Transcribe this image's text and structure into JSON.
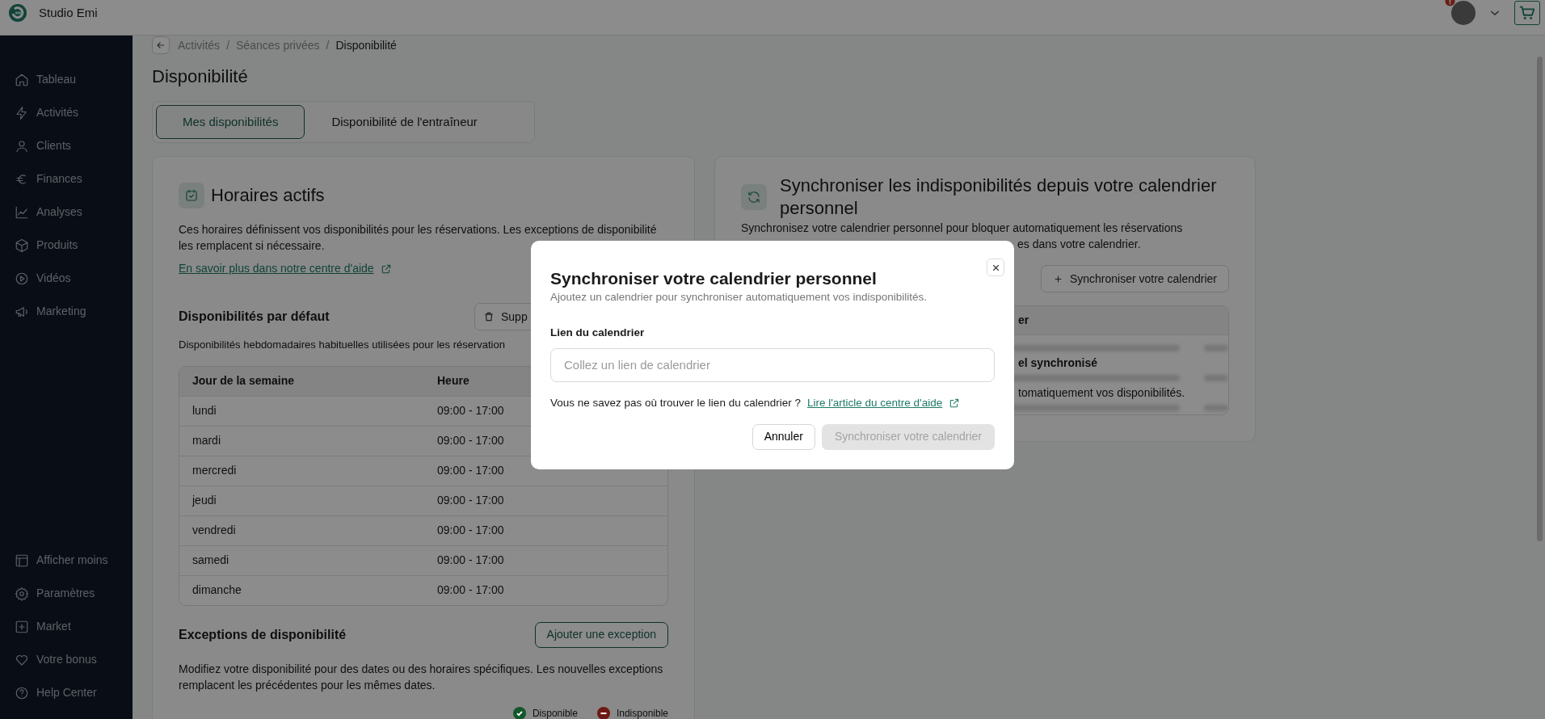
{
  "header": {
    "brand": "Studio Emi"
  },
  "sidebar": {
    "items": [
      {
        "label": "Tableau"
      },
      {
        "label": "Activités"
      },
      {
        "label": "Clients"
      },
      {
        "label": "Finances"
      },
      {
        "label": "Analyses"
      },
      {
        "label": "Produits"
      },
      {
        "label": "Vidéos"
      },
      {
        "label": "Marketing"
      }
    ],
    "bottom_items": [
      {
        "label": "Afficher moins"
      },
      {
        "label": "Paramètres"
      },
      {
        "label": "Market"
      },
      {
        "label": "Votre bonus"
      },
      {
        "label": "Help Center"
      }
    ]
  },
  "breadcrumb": {
    "items": [
      "Activités",
      "Séances privées",
      "Disponibilité"
    ],
    "separators": [
      "/",
      "/"
    ]
  },
  "page_title": "Disponibilité",
  "tabs": [
    {
      "label": "Mes disponibilités",
      "selected": true
    },
    {
      "label": "Disponibilité de l'entraîneur",
      "selected": false
    }
  ],
  "schedule_card": {
    "title": "Horaires actifs",
    "description": "Ces horaires définissent vos disponibilités pour les réservations. Les exceptions de disponibilité les remplacent si nécessaire.",
    "help_link": "En savoir plus dans notre centre d'aide",
    "default_section": {
      "title": "Disponibilités par défaut",
      "delete_button": "Supp",
      "description": "Disponibilités hebdomadaires habituelles utilisées pour les réservation",
      "table": {
        "columns": [
          "Jour de la semaine",
          "Heure"
        ],
        "rows": [
          [
            "lundi",
            "09:00 - 17:00"
          ],
          [
            "mardi",
            "09:00 - 17:00"
          ],
          [
            "mercredi",
            "09:00 - 17:00"
          ],
          [
            "jeudi",
            "09:00 - 17:00"
          ],
          [
            "vendredi",
            "09:00 - 17:00"
          ],
          [
            "samedi",
            "09:00 - 17:00"
          ],
          [
            "dimanche",
            "09:00 - 17:00"
          ]
        ]
      }
    },
    "exceptions_section": {
      "title": "Exceptions de disponibilité",
      "add_button": "Ajouter une exception",
      "description": "Modifiez votre disponibilité pour des dates ou des horaires spécifiques. Les nouvelles exceptions remplacent les précédentes pour les mêmes dates.",
      "legend": [
        {
          "kind": "check",
          "label": "Disponible",
          "color": "#13582a"
        },
        {
          "kind": "minus",
          "label": "Indisponible",
          "color": "#6e1a14"
        }
      ]
    }
  },
  "sync_card": {
    "title": "Synchroniser les indisponibilités depuis votre calendrier personnel",
    "description_line_1": "Synchronisez votre calendrier personnel pour bloquer automatiquement les réservations",
    "description_line_2": "es dans votre calendrier.",
    "sync_button": "Synchroniser votre calendrier",
    "table": {
      "column_1": "er",
      "empty_title": "el synchronisé",
      "empty_text": "tomatiquement vos disponibilités."
    }
  },
  "modal": {
    "title": "Synchroniser votre calendrier personnel",
    "subtitle": "Ajoutez un calendrier pour synchroniser automatiquement vos indisponibilités.",
    "field_label": "Lien du calendrier",
    "placeholder": "Collez un lien de calendrier",
    "help_text": "Vous ne savez pas où trouver le lien du calendrier ?",
    "help_link": "Lire l'article du centre d'aide",
    "cancel_button": "Annuler",
    "submit_button": {
      "label": "Synchroniser votre calendrier",
      "disabled": true
    }
  }
}
